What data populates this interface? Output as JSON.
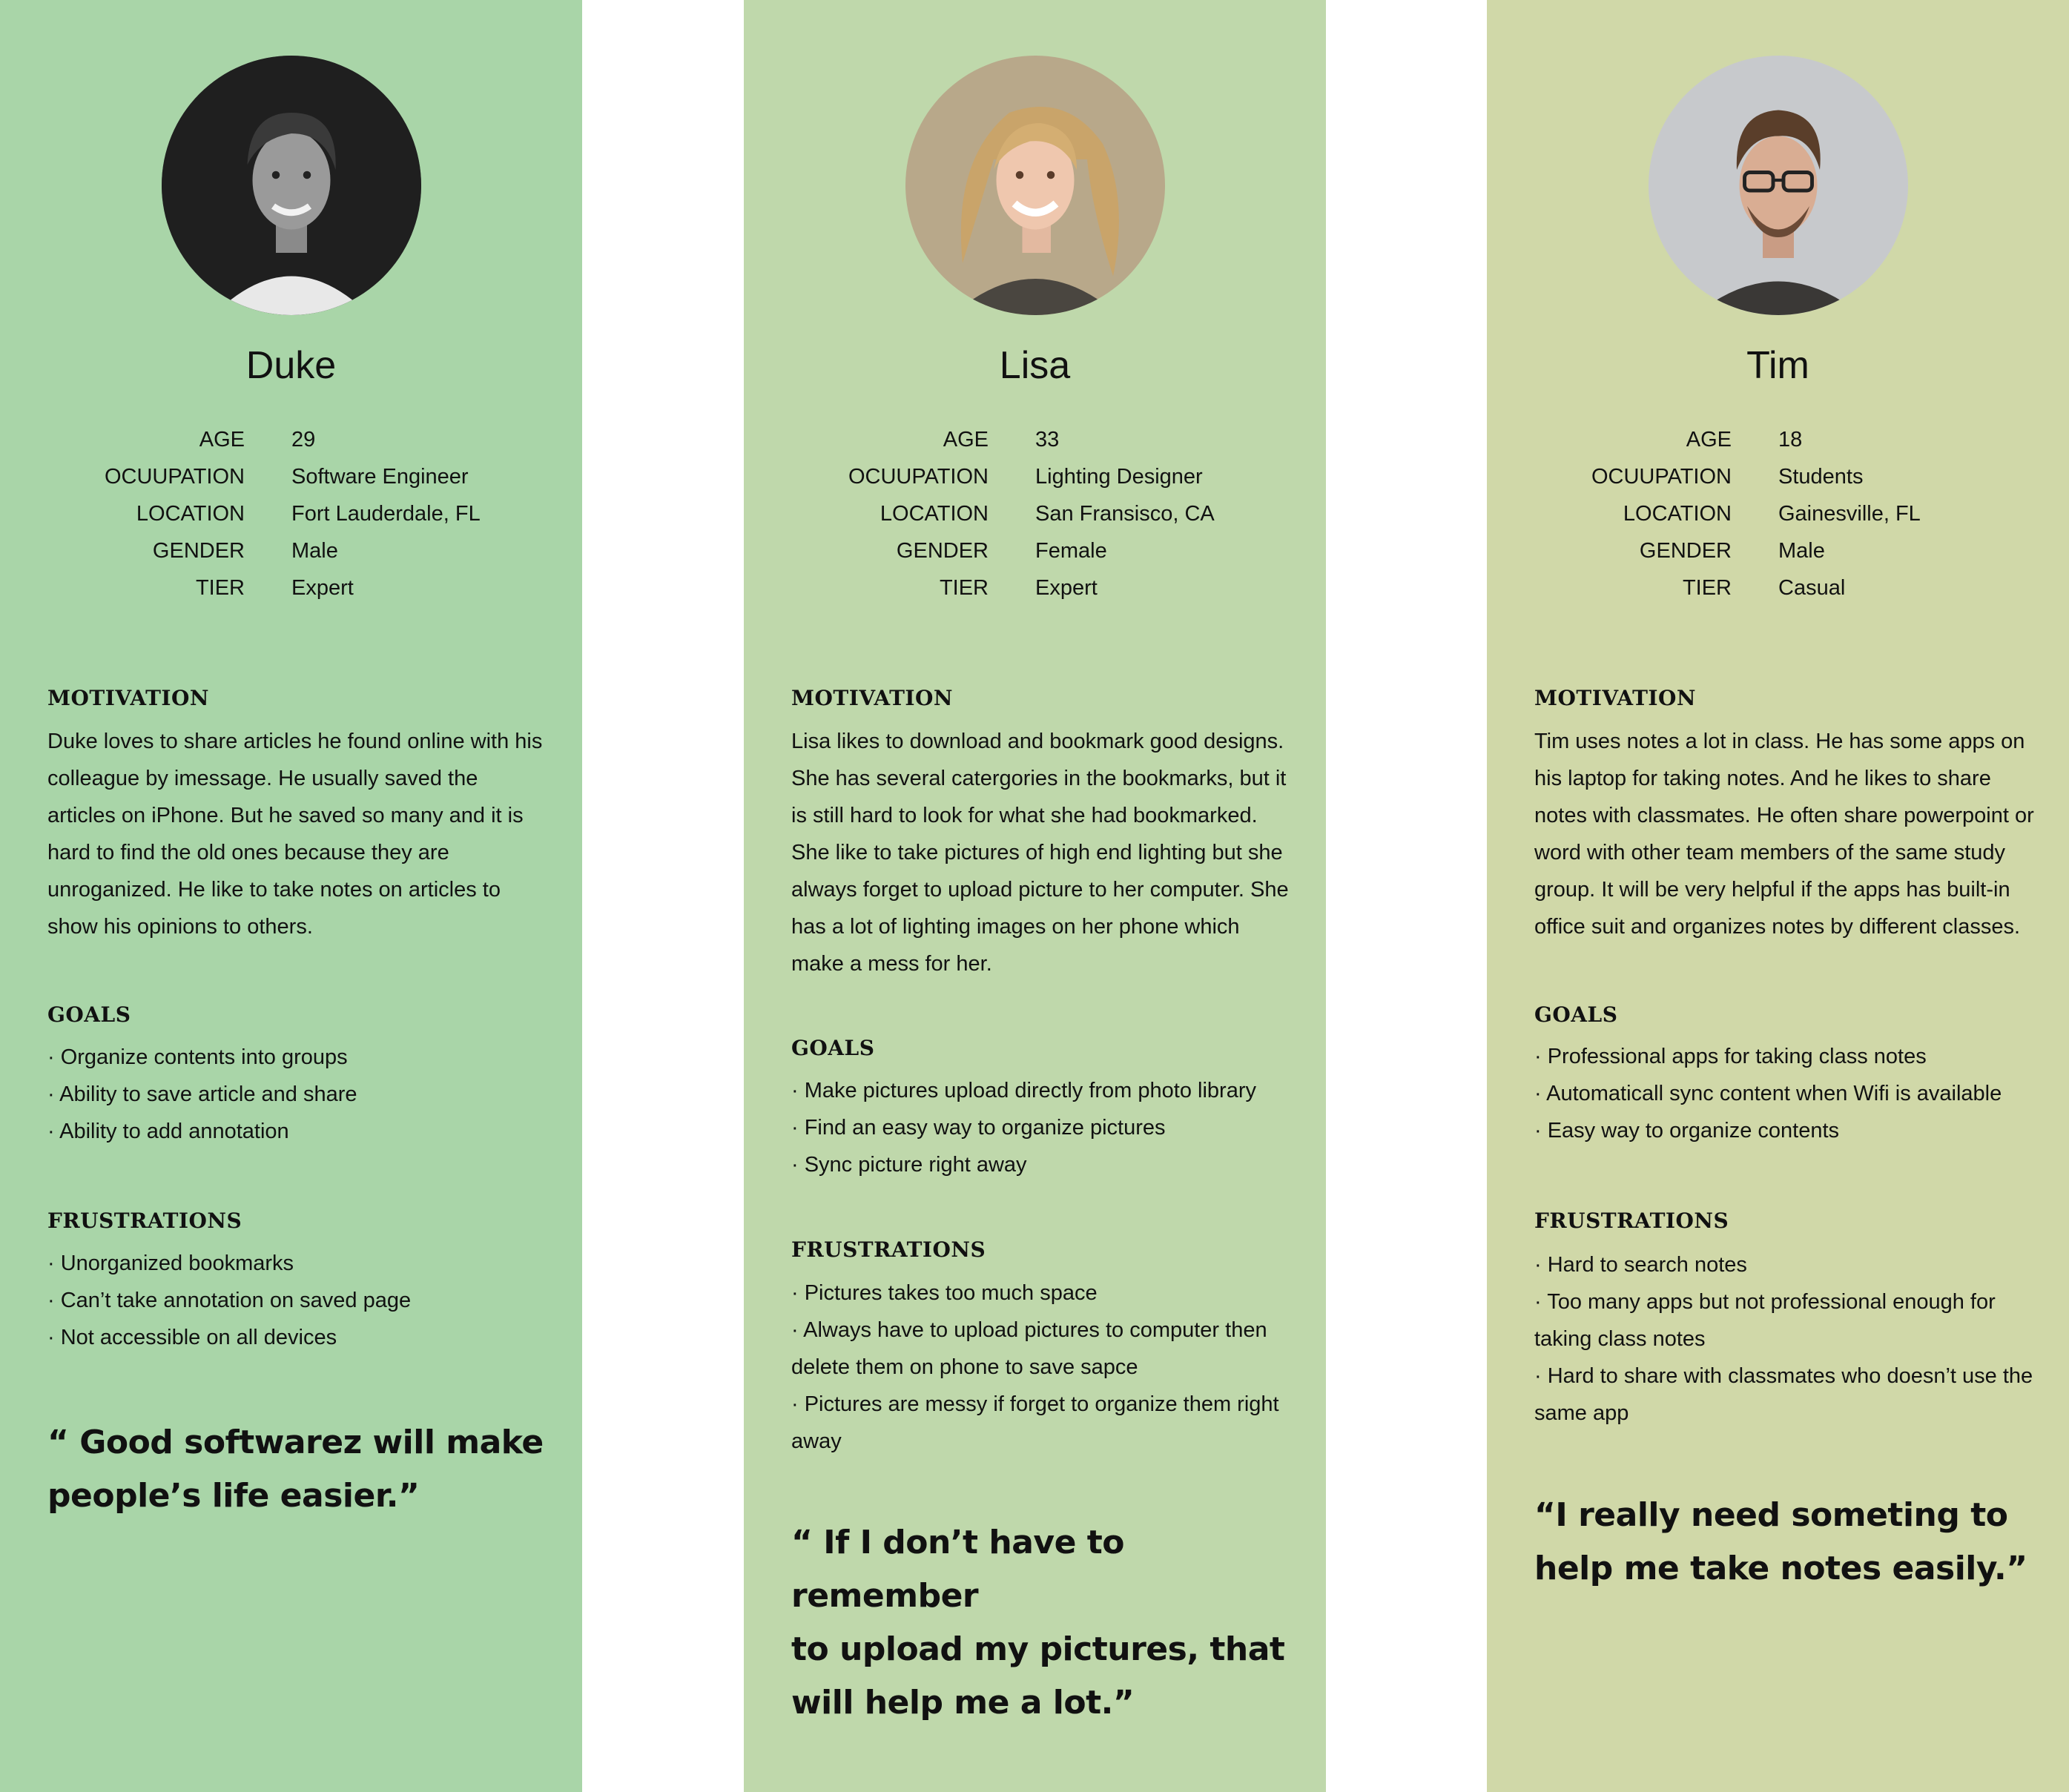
{
  "personas": [
    {
      "name": "Duke",
      "info": [
        {
          "label": "AGE",
          "value": "29"
        },
        {
          "label": "OCUUPATION",
          "value": "Software Engineer"
        },
        {
          "label": "LOCATION",
          "value": "Fort Lauderdale, FL"
        },
        {
          "label": "GENDER",
          "value": "Male"
        },
        {
          "label": "TIER",
          "value": "Expert"
        }
      ],
      "motivation_title": "MOTIVATION",
      "motivation_lines": [
        "Duke loves to share articles he found online with his",
        "colleague by imessage. He usually saved the",
        "articles on iPhone. But he saved so many and it is",
        "hard to find the old ones because they are",
        "unroganized. He like to take notes on articles to",
        "show his opinions to others."
      ],
      "goals_title": "GOALS",
      "goals": [
        "· Organize contents into groups",
        "· Ability to save article and share",
        "· Ability to add annotation"
      ],
      "frustrations_title": "FRUSTRATIONS",
      "frustrations": [
        "· Unorganized bookmarks",
        "· Can’t take annotation on saved page",
        "· Not accessible on all devices"
      ],
      "quote_lines": [
        "“ Good softwarez will make",
        "people’s life easier.”"
      ]
    },
    {
      "name": "Lisa",
      "info": [
        {
          "label": "AGE",
          "value": "33"
        },
        {
          "label": "OCUUPATION",
          "value": "Lighting Designer"
        },
        {
          "label": "LOCATION",
          "value": "San Fransisco, CA"
        },
        {
          "label": "GENDER",
          "value": "Female"
        },
        {
          "label": "TIER",
          "value": "Expert"
        }
      ],
      "motivation_title": "MOTIVATION",
      "motivation_lines": [
        "Lisa likes to download and bookmark good designs.",
        "She has several catergories in the bookmarks, but it",
        "is still hard to look for what she had bookmarked.",
        "She like to take pictures of high end lighting but she",
        "always forget to upload picture to her computer. She",
        "has a lot of lighting images on her phone  which",
        "make a mess for her."
      ],
      "goals_title": "GOALS",
      "goals": [
        "· Make pictures upload directly from photo library",
        "· Find an easy way to organize pictures",
        "· Sync picture right away"
      ],
      "frustrations_title": "FRUSTRATIONS",
      "frustrations": [
        "· Pictures takes too much space",
        "· Always have to upload pictures to computer then",
        "delete them on phone to save sapce",
        " · Pictures are messy if forget to organize them right",
        "away"
      ],
      "quote_lines": [
        "“ If I don’t have to remember",
        "to upload my pictures, that",
        "will help me a lot.”"
      ]
    },
    {
      "name": "Tim",
      "info": [
        {
          "label": "AGE",
          "value": "18"
        },
        {
          "label": "OCUUPATION",
          "value": "Students"
        },
        {
          "label": "LOCATION",
          "value": "Gainesville, FL"
        },
        {
          "label": "GENDER",
          "value": "Male"
        },
        {
          "label": "TIER",
          "value": "Casual"
        }
      ],
      "motivation_title": "MOTIVATION",
      "motivation_lines": [
        "Tim uses notes a lot in class. He has some apps on",
        "his laptop for taking notes. And he likes to share",
        "notes with classmates. He often share powerpoint or",
        "word with other team members of the same study",
        "group. It will be very helpful if the apps has built-in",
        "office suit and organizes notes by different classes."
      ],
      "goals_title": "GOALS",
      "goals": [
        "· Professional apps for taking class notes",
        "· Automaticall sync content when Wifi is available",
        "· Easy way to organize contents"
      ],
      "frustrations_title": "FRUSTRATIONS",
      "frustrations": [
        "· Hard to search notes",
        "· Too many apps but not professional enough for",
        "taking class notes",
        "· Hard to share with classmates who doesn’t use the",
        "same app"
      ],
      "quote_lines": [
        "“I really need someting to",
        "help me take notes easily.”"
      ]
    }
  ]
}
